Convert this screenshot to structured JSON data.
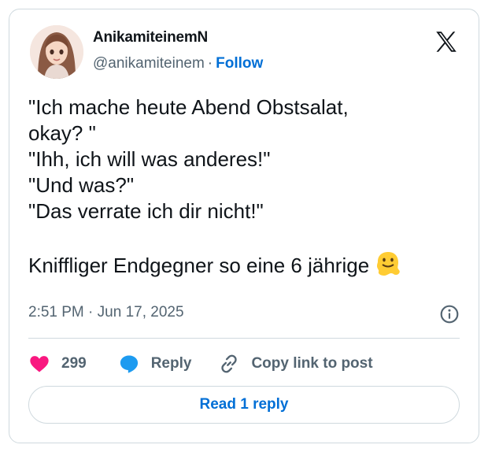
{
  "author": {
    "display_name": "AnikamiteinemN",
    "handle": "@anikamiteinem",
    "separator": "·",
    "follow_label": "Follow"
  },
  "tweet": {
    "text": "\"Ich mache heute Abend Obstsalat,\nokay? \"\n\"Ihh, ich will was anderes!\"\n\"Und was?\"\n\"Das verrate ich dir nicht!\"\n\nKniffliger Endgegner so eine 6 jährige",
    "emoji": "melting-face-emoji",
    "time": "2:51 PM",
    "date_separator": "·",
    "date": "Jun 17, 2025"
  },
  "actions": {
    "like_count": "299",
    "reply_label": "Reply",
    "copy_label": "Copy link to post"
  },
  "footer": {
    "read_replies_label": "Read 1 reply"
  },
  "icons": {
    "logo": "x-logo-icon",
    "info": "info-icon",
    "like": "heart-icon",
    "reply": "speech-bubble-icon",
    "copy": "link-icon"
  },
  "colors": {
    "heart": "#f91880",
    "reply_bubble": "#1d9bf0",
    "link_blue": "#006fd6",
    "secondary_text": "#536471",
    "border": "#cfd9de"
  }
}
